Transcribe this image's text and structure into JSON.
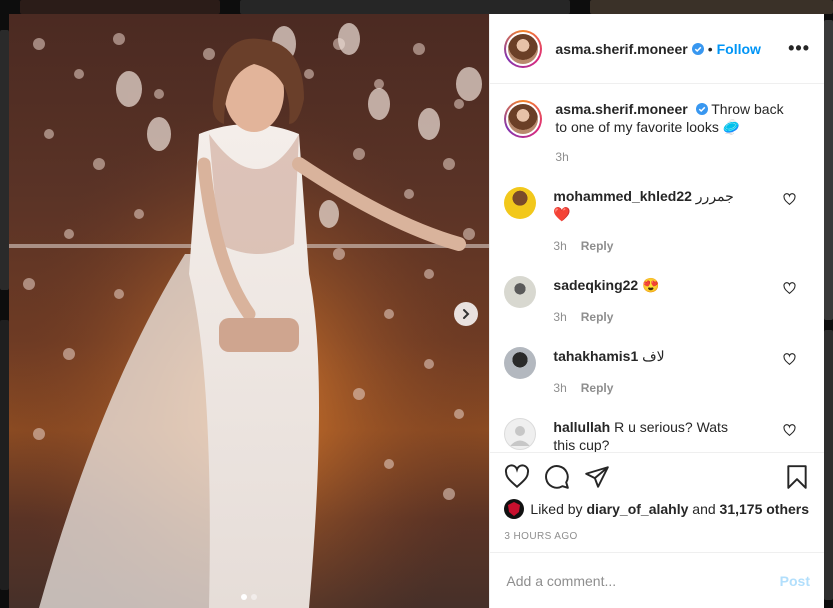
{
  "post": {
    "author": {
      "username": "asma.sherif.moneer",
      "follow_label": "Follow",
      "separator": "•",
      "more_label": "•••"
    },
    "caption": {
      "username": "asma.sherif.moneer",
      "text": "Throw back to one of my favorite looks 🥏",
      "age": "3h"
    },
    "comments": [
      {
        "username": "mohammed_khled22",
        "text": "جمررر ❤️",
        "age": "3h",
        "reply_label": "Reply"
      },
      {
        "username": "sadeqking22",
        "text": "😍",
        "age": "3h",
        "reply_label": "Reply"
      },
      {
        "username": "tahakhamis1",
        "text": "لاف",
        "age": "3h",
        "reply_label": "Reply"
      },
      {
        "username": "hallullah",
        "text": "R u serious? Wats this cup?",
        "age": "",
        "reply_label": ""
      }
    ],
    "likes": {
      "prefix": "Liked by",
      "user": "diary_of_alahly",
      "conjunction": "and",
      "others": "31,175 others"
    },
    "timestamp": "3 HOURS AGO",
    "add_comment": {
      "placeholder": "Add a comment...",
      "post_label": "Post"
    },
    "carousel": {
      "slides": 2,
      "active": 0
    }
  },
  "colors": {
    "link": "#0095f6",
    "post_disabled": "#b2dffc",
    "secondary_text": "#8e8e8e",
    "primary_text": "#262626"
  },
  "icons": [
    "verified-badge-icon",
    "more-options-icon",
    "heart-icon",
    "comment-icon",
    "share-icon",
    "bookmark-icon",
    "chevron-right-icon"
  ]
}
